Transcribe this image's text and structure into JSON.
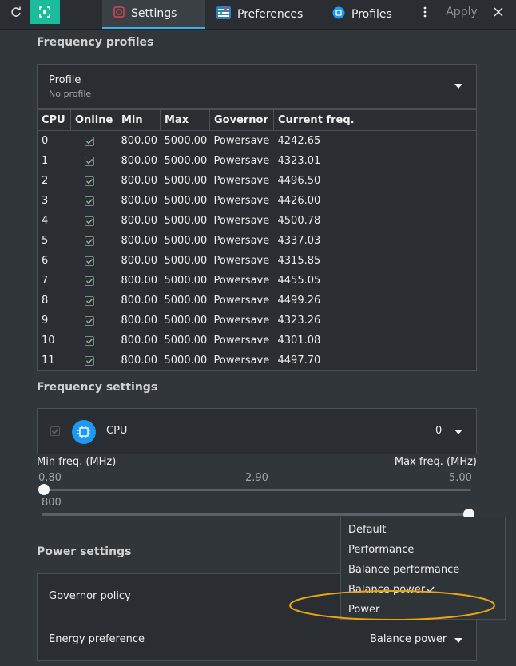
{
  "toolbar": {
    "refresh_icon": "refresh-icon",
    "fullscreen_icon": "fullscreen-icon",
    "tabs": [
      {
        "label": "Settings",
        "icon": "settings-icon"
      },
      {
        "label": "Preferences",
        "icon": "sliders-icon"
      },
      {
        "label": "Profiles",
        "icon": "profiles-icon"
      }
    ],
    "apply_label": "Apply",
    "accent": "#3daee9"
  },
  "frequency_profiles": {
    "title": "Frequency profiles",
    "profile_label": "Profile",
    "profile_value": "No profile",
    "columns": [
      "CPU",
      "Online",
      "Min",
      "Max",
      "Governor",
      "Current freq."
    ],
    "rows": [
      {
        "cpu": "0",
        "online": true,
        "min": "800.00",
        "max": "5000.00",
        "governor": "Powersave",
        "current": "4242.65"
      },
      {
        "cpu": "1",
        "online": true,
        "min": "800.00",
        "max": "5000.00",
        "governor": "Powersave",
        "current": "4323.01"
      },
      {
        "cpu": "2",
        "online": true,
        "min": "800.00",
        "max": "5000.00",
        "governor": "Powersave",
        "current": "4496.50"
      },
      {
        "cpu": "3",
        "online": true,
        "min": "800.00",
        "max": "5000.00",
        "governor": "Powersave",
        "current": "4426.00"
      },
      {
        "cpu": "4",
        "online": true,
        "min": "800.00",
        "max": "5000.00",
        "governor": "Powersave",
        "current": "4500.78"
      },
      {
        "cpu": "5",
        "online": true,
        "min": "800.00",
        "max": "5000.00",
        "governor": "Powersave",
        "current": "4337.03"
      },
      {
        "cpu": "6",
        "online": true,
        "min": "800.00",
        "max": "5000.00",
        "governor": "Powersave",
        "current": "4315.85"
      },
      {
        "cpu": "7",
        "online": true,
        "min": "800.00",
        "max": "5000.00",
        "governor": "Powersave",
        "current": "4455.05"
      },
      {
        "cpu": "8",
        "online": true,
        "min": "800.00",
        "max": "5000.00",
        "governor": "Powersave",
        "current": "4499.26"
      },
      {
        "cpu": "9",
        "online": true,
        "min": "800.00",
        "max": "5000.00",
        "governor": "Powersave",
        "current": "4323.26"
      },
      {
        "cpu": "10",
        "online": true,
        "min": "800.00",
        "max": "5000.00",
        "governor": "Powersave",
        "current": "4301.08"
      },
      {
        "cpu": "11",
        "online": true,
        "min": "800.00",
        "max": "5000.00",
        "governor": "Powersave",
        "current": "4497.70"
      }
    ]
  },
  "frequency_settings": {
    "title": "Frequency settings",
    "cpu_label": "CPU",
    "cpu_value": "0",
    "min_label": "Min freq. (MHz)",
    "max_label": "Max freq. (MHz)",
    "scale_left": "0.80",
    "scale_mid": "2.90",
    "scale_right": "5.00",
    "min_value": "800",
    "min_fraction": 0.0,
    "max_fraction": 1.0
  },
  "power_settings": {
    "title": "Power settings",
    "governor_label": "Governor policy",
    "energy_label": "Energy preference",
    "energy_value": "Balance power"
  },
  "dropdown_menu": {
    "items": [
      "Default",
      "Performance",
      "Balance performance",
      "Balance power",
      "Power"
    ],
    "checked": "Balance power",
    "highlight_color": "#e8a317"
  }
}
